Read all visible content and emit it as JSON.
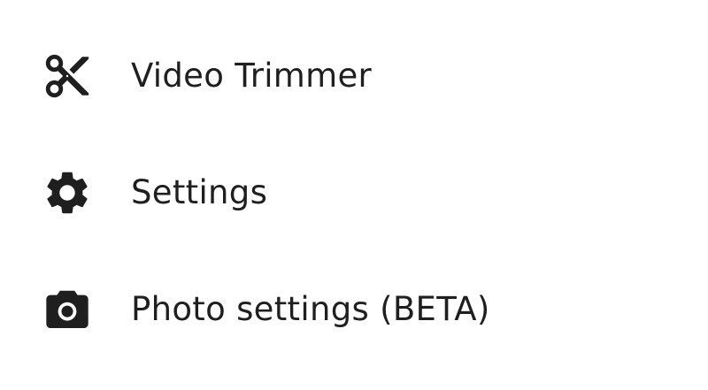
{
  "menu": {
    "items": [
      {
        "label": "Video Trimmer",
        "icon": "scissors-icon"
      },
      {
        "label": "Settings",
        "icon": "gear-icon"
      },
      {
        "label": "Photo settings (BETA)",
        "icon": "camera-icon"
      }
    ]
  },
  "colors": {
    "text": "#1f1f1f",
    "icon": "#1f1f1f",
    "background": "#ffffff"
  }
}
